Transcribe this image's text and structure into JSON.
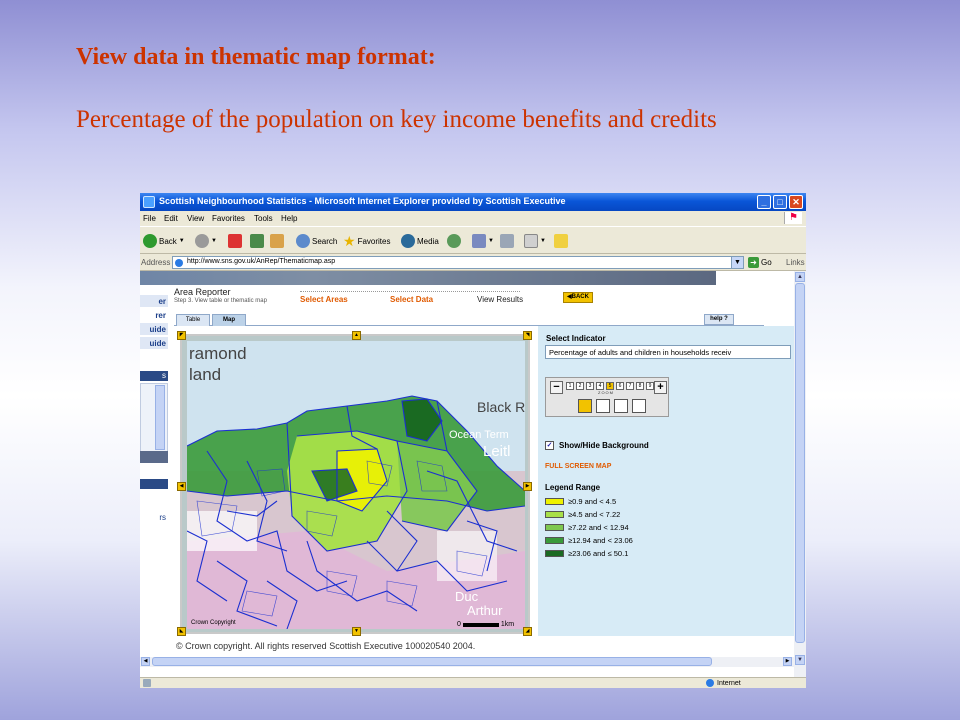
{
  "slide": {
    "title": "View data in thematic map format:",
    "subtitle": "Percentage of the population on key income benefits and credits"
  },
  "window": {
    "title": "Scottish Neighbourhood Statistics - Microsoft Internet Explorer provided by Scottish Executive",
    "controls": {
      "minimize": "_",
      "maximize": "□",
      "close": "✕"
    }
  },
  "menu": [
    "File",
    "Edit",
    "View",
    "Favorites",
    "Tools",
    "Help"
  ],
  "toolbar": {
    "back": "Back",
    "search": "Search",
    "favorites": "Favorites",
    "media": "Media"
  },
  "address": {
    "label": "Address",
    "url": "http://www.sns.gov.uk/AnRep/Thematicmap.asp",
    "go": "Go",
    "links": "Links"
  },
  "sidebar": {
    "items": [
      "er",
      "rer",
      "uide",
      "uide",
      "s",
      "rs"
    ]
  },
  "reporter": {
    "heading": "Area Reporter",
    "step": "Step 3. View table or thematic map",
    "steps": [
      "Select Areas",
      "Select Data",
      "View Results"
    ],
    "back": "◀BACK",
    "tabs": [
      "Table",
      "Map"
    ],
    "help": "help ?"
  },
  "map": {
    "labels": [
      "ramond",
      "land",
      "Black R",
      "Ocean Term",
      "Leitl",
      "Duc",
      "Arthur"
    ],
    "copyright_small": "Crown Copyright",
    "scale": [
      "0",
      "1km"
    ]
  },
  "panel": {
    "select_indicator": "Select Indicator",
    "indicator_value": "Percentage of adults and children in households receiv",
    "zoom_levels": [
      "1",
      "2",
      "3",
      "4",
      "5",
      "6",
      "7",
      "8",
      "9"
    ],
    "zoom_selected": 5,
    "zoom_label": "ZOOM",
    "show_bg": "Show/Hide Background",
    "show_bg_checked": true,
    "full_screen": "FULL SCREEN MAP",
    "legend_title": "Legend Range",
    "legend": [
      {
        "label": "≥0.9 and < 4.5",
        "color": "#eef200"
      },
      {
        "label": "≥4.5 and < 7.22",
        "color": "#a8e048"
      },
      {
        "label": "≥7.22 and < 12.94",
        "color": "#7ec850"
      },
      {
        "label": "≥12.94 and < 23.06",
        "color": "#3a9a3a"
      },
      {
        "label": "≥23.06 and ≤ 50.1",
        "color": "#1a6a22"
      }
    ]
  },
  "footer": {
    "copyright": "© Crown copyright. All rights reserved Scottish Executive 100020540 2004."
  },
  "status": {
    "zone": "Internet"
  }
}
